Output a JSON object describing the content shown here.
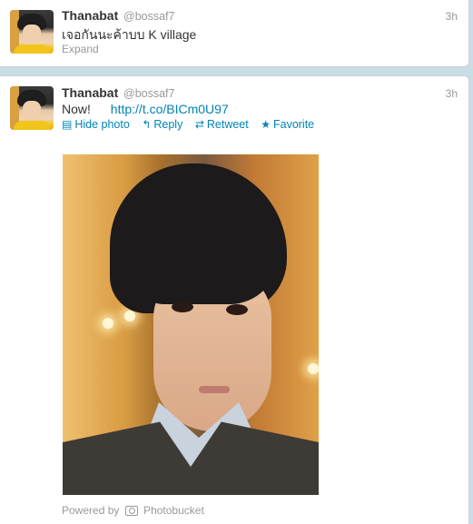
{
  "tweets": [
    {
      "name": "Thanabat",
      "handle": "@bossaf7",
      "time": "3h",
      "text": "เจอกันนะค้าบบ K village",
      "expand_label": "Expand"
    },
    {
      "name": "Thanabat",
      "handle": "@bossaf7",
      "time": "3h",
      "text": "Now!",
      "link": "http://t.co/BICm0U97",
      "actions": {
        "hide_photo": "Hide photo",
        "reply": "Reply",
        "retweet": "Retweet",
        "favorite": "Favorite"
      },
      "powered_by": "Powered by",
      "photo_service": "Photobucket"
    }
  ],
  "colors": {
    "link": "#0084b4",
    "muted": "#999999",
    "text": "#333333",
    "background": "#c9dde6"
  },
  "icons": [
    "photo-icon",
    "reply-icon",
    "retweet-icon",
    "favorite-star-icon",
    "camera-icon"
  ]
}
